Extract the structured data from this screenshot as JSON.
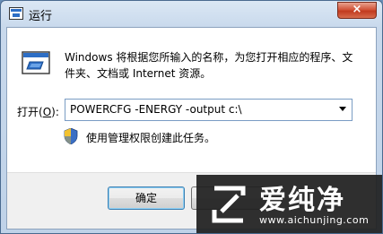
{
  "window": {
    "title": "运行",
    "icon": "run-window-icon",
    "close_label": "×"
  },
  "dialog": {
    "description": "Windows 将根据您所输入的名称，为您打开相应的程序、文件夹、文档或 Internet 资源。",
    "open_label_prefix": "打开(",
    "open_label_key": "O",
    "open_label_suffix": "):",
    "command_value": "POWERCFG -ENERGY -output c:\\",
    "admin_note": "使用管理权限创建此任务。"
  },
  "buttons": {
    "ok_label": "确定"
  },
  "watermark": {
    "title": "爱纯净",
    "url": "www.aichunjing.com"
  }
}
